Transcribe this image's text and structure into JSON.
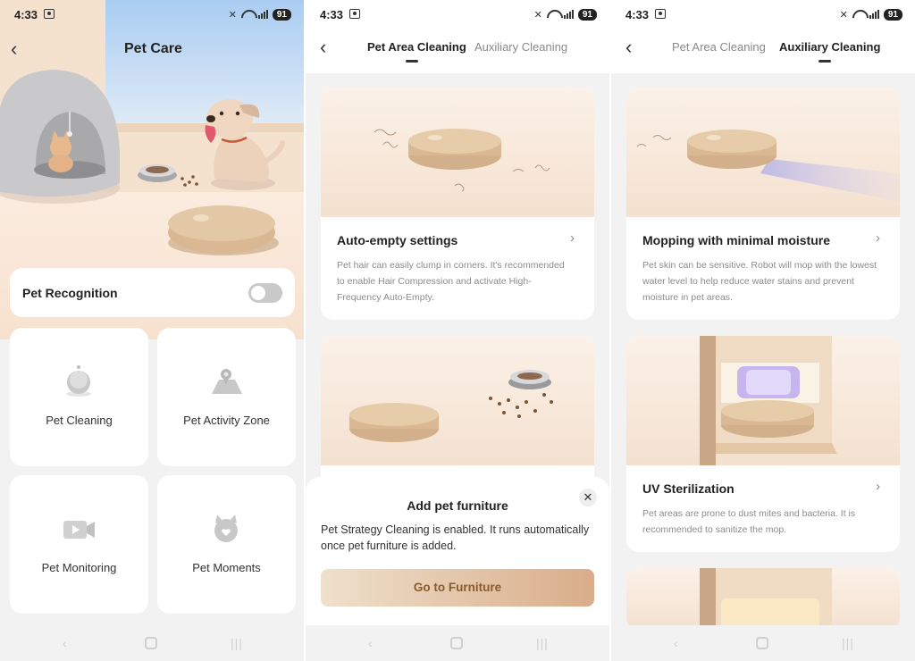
{
  "status": {
    "time": "4:33",
    "battery": "91"
  },
  "screen1": {
    "title": "Pet Care",
    "recognition_label": "Pet Recognition",
    "tiles": [
      {
        "label": "Pet Cleaning"
      },
      {
        "label": "Pet Activity Zone"
      },
      {
        "label": "Pet Monitoring"
      },
      {
        "label": "Pet Moments"
      }
    ]
  },
  "tabs": {
    "area": "Pet Area Cleaning",
    "aux": "Auxiliary Cleaning"
  },
  "screen2": {
    "card1": {
      "title": "Auto-empty settings",
      "desc": "Pet hair can easily clump in corners. It's recommended to enable Hair Compression and activate High-Frequency Auto-Empty."
    },
    "modal": {
      "title": "Add pet furniture",
      "body": "Pet Strategy Cleaning is enabled. It runs automatically once pet furniture is added.",
      "button": "Go to Furniture"
    }
  },
  "screen3": {
    "card1": {
      "title": "Mopping with minimal moisture",
      "desc": "Pet skin can be sensitive. Robot will mop with the lowest water level to help reduce water stains and prevent moisture in pet areas."
    },
    "card2": {
      "title": "UV Sterilization",
      "desc": "Pet areas are prone to dust mites and bacteria. It is recommended to sanitize the mop."
    }
  },
  "colors": {
    "accent_text": "#8b5a2b",
    "button_gradient_start": "#efe0cc",
    "button_gradient_end": "#d9ad8a",
    "toggle_off": "#c9c9c9"
  }
}
